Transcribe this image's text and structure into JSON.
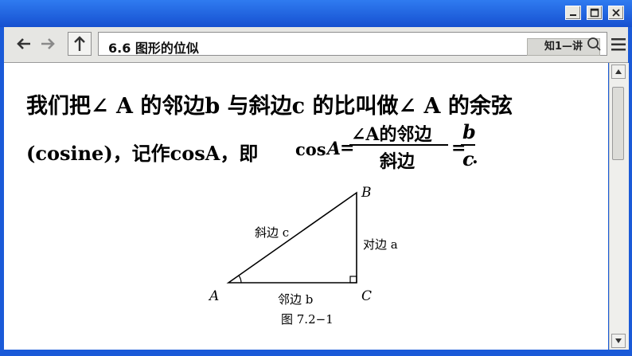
{
  "window": {
    "controls": [
      "minimize-icon",
      "maximize-icon",
      "close-icon"
    ]
  },
  "toolbar": {
    "address_text": "6.6 图形的位似",
    "tag_label": "知1—讲",
    "icons": [
      "back-arrow-icon",
      "forward-arrow-icon",
      "up-arrow-icon",
      "search-icon",
      "menu-icon"
    ]
  },
  "content": {
    "line1": "我们把∠ A 的邻边b 与斜边c 的比叫做∠ A 的余弦",
    "line2": "(cosine)，记作cosA，即",
    "formula": {
      "lhs_func": "cos",
      "lhs_var": "A",
      "equals": "=",
      "numerator": "∠A的邻边",
      "denominator": "斜边",
      "equals2": "=",
      "rhs_num": "b",
      "rhs_den": "c",
      "period": "."
    },
    "figure": {
      "vertex_a": "A",
      "vertex_b": "B",
      "vertex_c": "C",
      "hypotenuse_label": "斜边 c",
      "opposite_label": "对边 a",
      "adjacent_label": "邻边 b",
      "caption": "图 7.2−1"
    }
  },
  "colors": {
    "title_bar": "#1a5ad8",
    "toolbar": "#e6e6e3",
    "content_bg": "#ffffff"
  }
}
